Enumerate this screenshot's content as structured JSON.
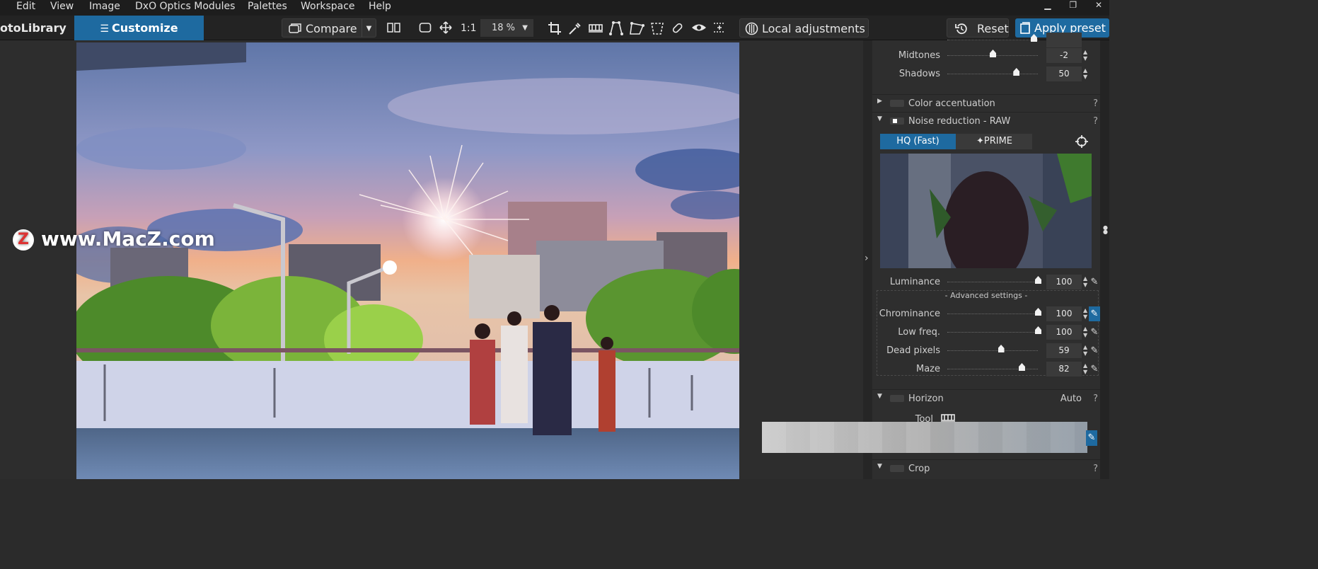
{
  "menu": [
    "Edit",
    "View",
    "Image",
    "DxO Optics Modules",
    "Palettes",
    "Workspace",
    "Help"
  ],
  "window_controls": {
    "minimize": "▁",
    "restore": "❐",
    "close": "✕"
  },
  "toolbar": {
    "photolibrary_label": "otoLibrary",
    "customize_label": "Customize",
    "compare_label": "Compare",
    "one_to_one": "1:1",
    "zoom_value": "18 %",
    "local_adjustments_label": "Local adjustments",
    "reset_label": "Reset",
    "apply_preset_label": "Apply preset"
  },
  "watermark": {
    "text": "www.MacZ.com",
    "logo": "Z"
  },
  "panel": {
    "tone_rows": [
      {
        "label": "Midtones",
        "value": "-2",
        "level": 0.5
      },
      {
        "label": "Shadows",
        "value": "50",
        "level": 0.76
      }
    ],
    "color_accentuation": {
      "title": "Color accentuation",
      "help": "?"
    },
    "noise_reduction": {
      "title": "Noise reduction - RAW",
      "help": "?",
      "mode_hq": "HQ (Fast)",
      "mode_prime": "✦PRIME",
      "luminance": {
        "label": "Luminance",
        "value": "100",
        "level": 1.0
      },
      "advanced_title": "- Advanced settings -",
      "advanced_rows": [
        {
          "label": "Chrominance",
          "value": "100",
          "level": 1.0,
          "wand_active": true
        },
        {
          "label": "Low freq.",
          "value": "100",
          "level": 1.0,
          "wand_active": false
        },
        {
          "label": "Dead pixels",
          "value": "59",
          "level": 0.59,
          "wand_active": false
        },
        {
          "label": "Maze",
          "value": "82",
          "level": 0.82,
          "wand_active": false
        }
      ]
    },
    "horizon": {
      "title": "Horizon",
      "extra": "Auto",
      "help": "?",
      "tool_label": "Tool"
    },
    "crop": {
      "title": "Crop",
      "help": "?"
    }
  },
  "colors": {
    "accent": "#1e6aa0",
    "panel_bg": "#2e2e2e",
    "menubar_bg": "#1d1d1d"
  }
}
